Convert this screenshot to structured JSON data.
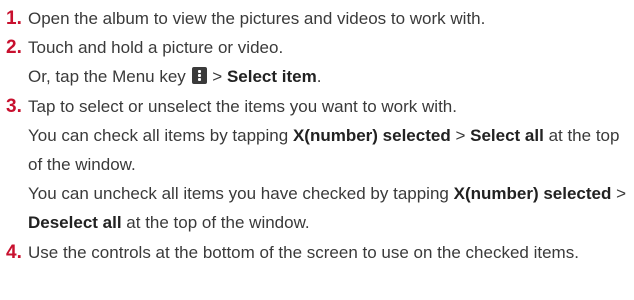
{
  "steps": [
    {
      "number": "1.",
      "text": "Open the album to view the pictures and videos to work with."
    },
    {
      "number": "2.",
      "text": "Touch and hold a picture or video.",
      "alt_prefix": "Or, tap the Menu key",
      "alt_sep": ">",
      "alt_bold": "Select item",
      "alt_suffix": "."
    },
    {
      "number": "3.",
      "text": "Tap to select or unselect the items you want to work with.",
      "p2_a": "You can check all items by tapping",
      "p2_b1": "X(number) selected",
      "p2_sep": ">",
      "p2_b2": "Select all",
      "p2_c": "at the top of the window.",
      "p3_a": "You can uncheck all items you have checked by tapping",
      "p3_b1": "X(number) selected",
      "p3_sep": ">",
      "p3_b2": "Deselect all",
      "p3_c": "at the top of the window."
    },
    {
      "number": "4.",
      "text": "Use the controls at the bottom of the screen to use on the checked items."
    }
  ],
  "colors": {
    "step_number": "#c8102e",
    "body_text": "#3a3a3a"
  },
  "icons": {
    "menu_key": "menu-key-icon"
  }
}
